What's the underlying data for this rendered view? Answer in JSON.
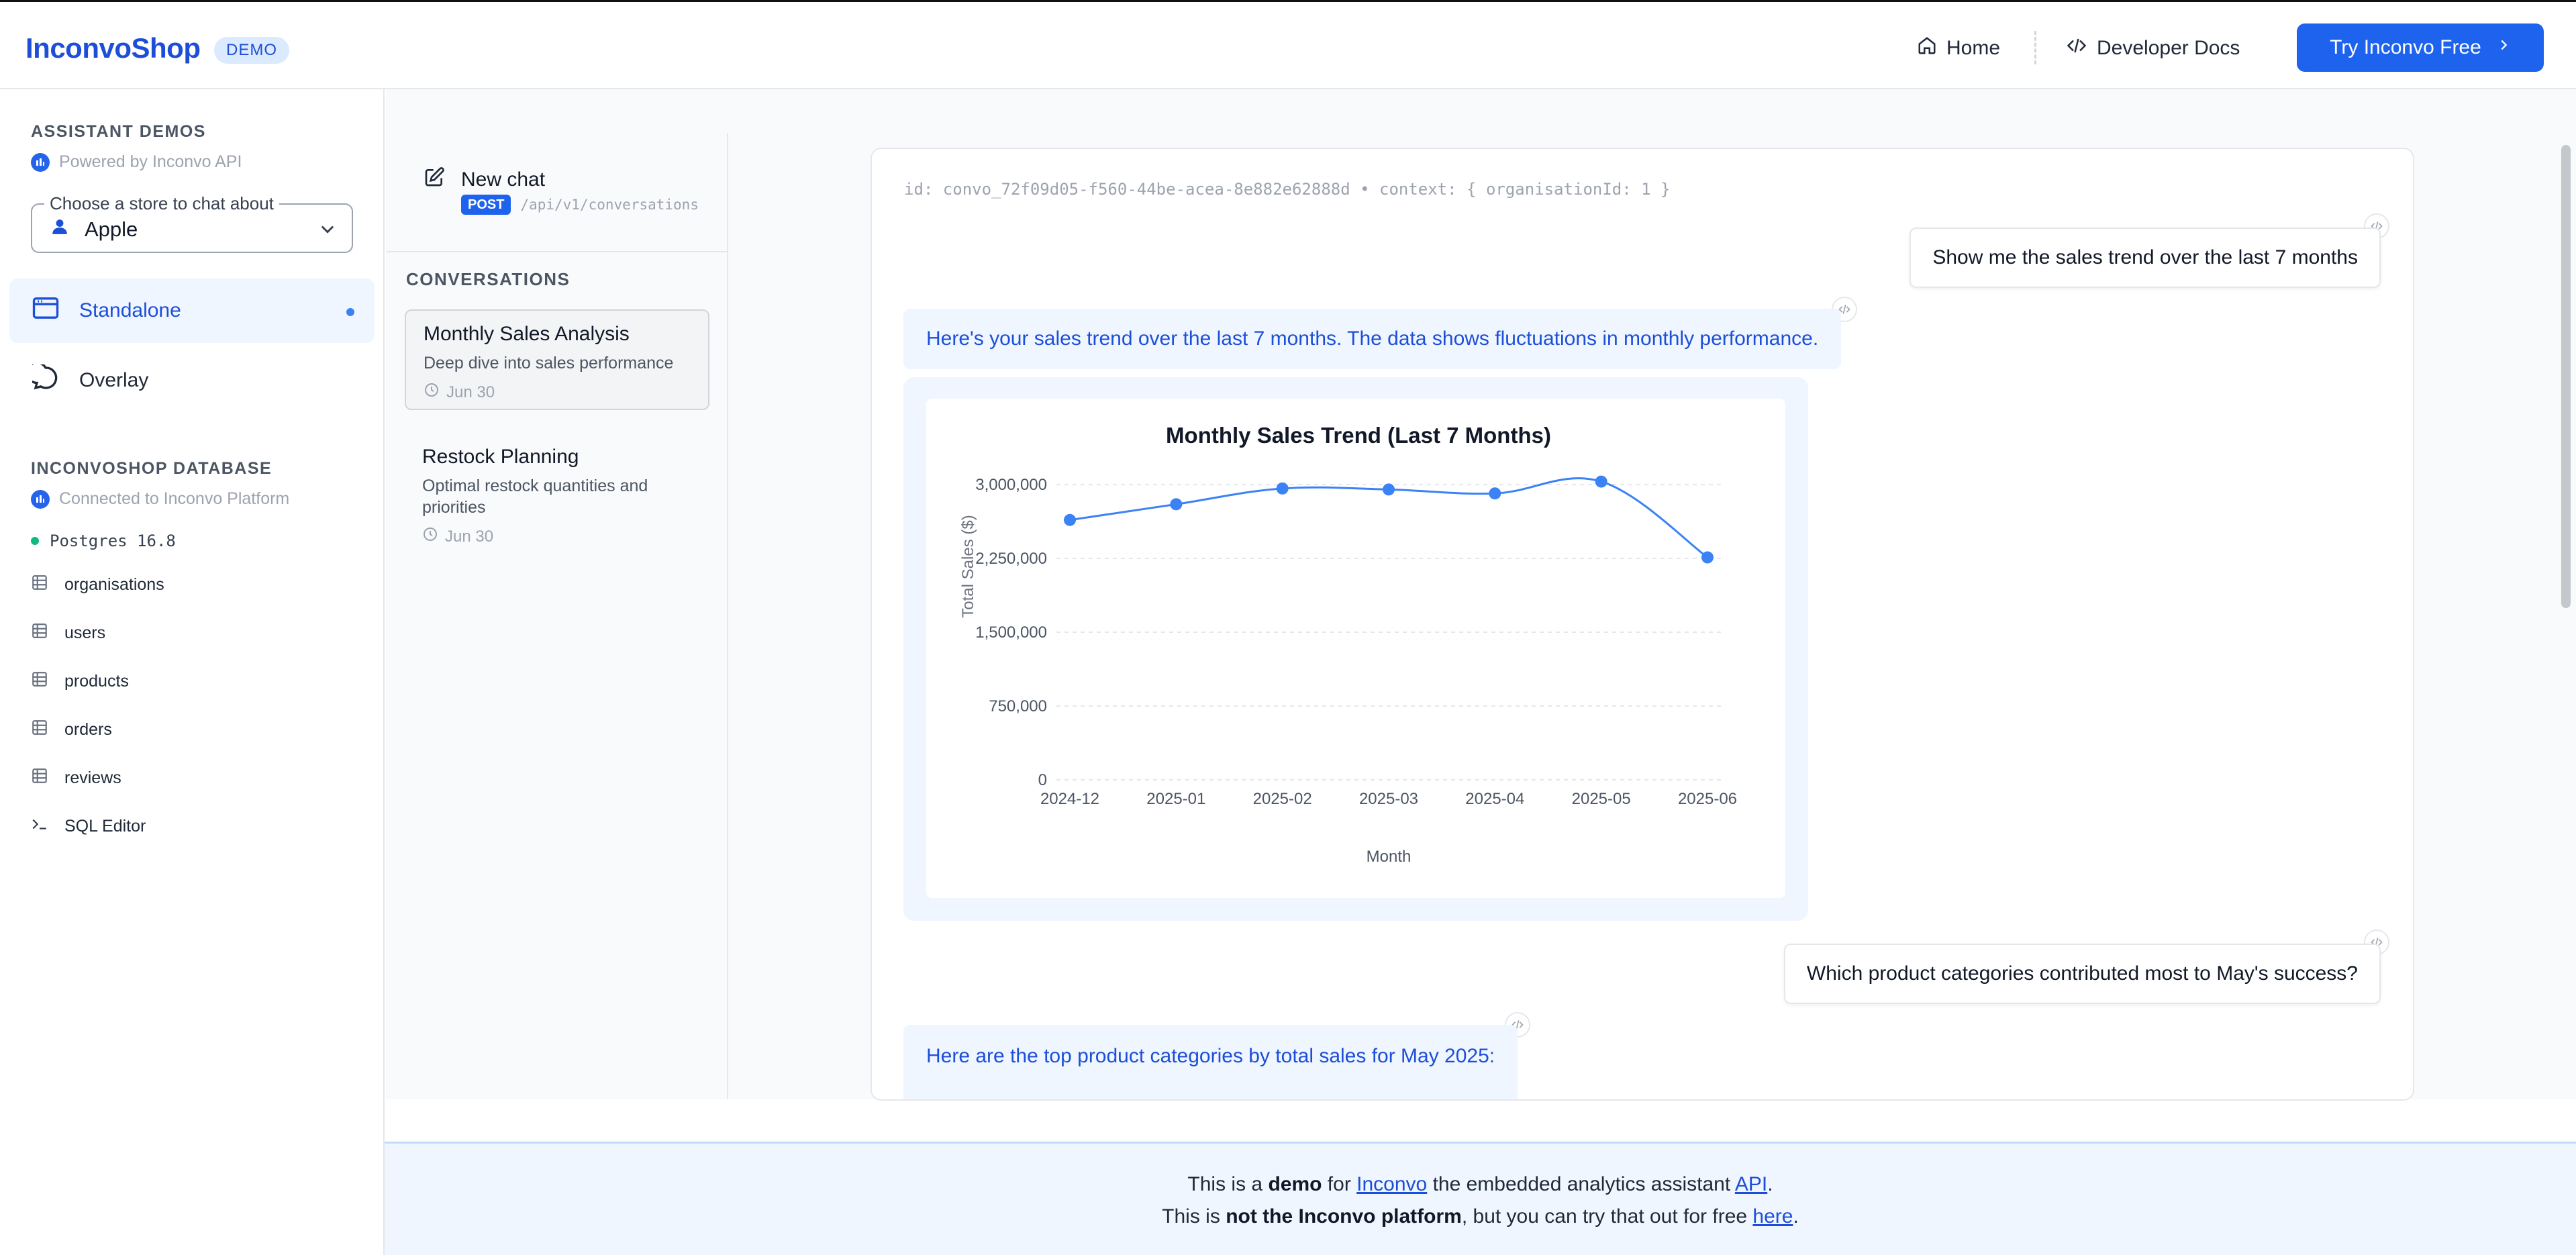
{
  "header": {
    "brand": "InconvoShop",
    "badge": "DEMO",
    "nav_home": "Home",
    "nav_docs": "Developer Docs",
    "cta": "Try Inconvo Free"
  },
  "sidebar": {
    "assistant_title": "ASSISTANT DEMOS",
    "assistant_sub": "Powered by Inconvo API",
    "store_legend": "Choose a store to chat about",
    "store_value": "Apple",
    "items": [
      {
        "label": "Standalone",
        "icon": "window-icon",
        "active": true
      },
      {
        "label": "Overlay",
        "icon": "chat-bubble-icon",
        "active": false
      }
    ],
    "db_title": "INCONVOSHOP DATABASE",
    "db_sub": "Connected to Inconvo Platform",
    "db_engine": "Postgres 16.8",
    "tables": [
      "organisations",
      "users",
      "products",
      "orders",
      "reviews"
    ],
    "sql_editor": "SQL Editor"
  },
  "conversations": {
    "new_chat": "New chat",
    "post_badge": "POST",
    "post_path": "/api/v1/conversations",
    "title": "CONVERSATIONS",
    "items": [
      {
        "title": "Monthly Sales Analysis",
        "subtitle": "Deep dive into sales performance",
        "date": "Jun 30",
        "selected": true
      },
      {
        "title": "Restock Planning",
        "subtitle": "Optimal restock quantities and priorities",
        "date": "Jun 30",
        "selected": false
      }
    ]
  },
  "chat": {
    "id_line": "id: convo_72f09d05-f560-44be-acea-8e882e62888d • context: { organisationId: 1 }",
    "messages": [
      {
        "role": "user",
        "text": "Show me the sales trend over the last 7 months"
      },
      {
        "role": "assistant",
        "text": "Here's your sales trend over the last 7 months. The data shows fluctuations in monthly performance."
      },
      {
        "role": "user",
        "text": "Which product categories contributed most to May's success?"
      },
      {
        "role": "assistant",
        "text": "Here are the top product categories by total sales for May 2025:"
      }
    ]
  },
  "chart_data": {
    "type": "line",
    "title": "Monthly Sales Trend (Last 7 Months)",
    "xlabel": "Month",
    "ylabel": "Total Sales ($)",
    "categories": [
      "2024-12",
      "2025-01",
      "2025-02",
      "2025-03",
      "2025-04",
      "2025-05",
      "2025-06"
    ],
    "values": [
      2640000,
      2800000,
      2960000,
      2950000,
      2910000,
      3030000,
      2260000
    ],
    "ylim": [
      0,
      3000000
    ],
    "yticks": [
      0,
      750000,
      1500000,
      2250000,
      3000000
    ],
    "ytick_labels": [
      "0",
      "750,000",
      "1,500,000",
      "2,250,000",
      "3,000,000"
    ],
    "grid": true,
    "color": "#3b82f6"
  },
  "footer": {
    "l1_pre": "This is a ",
    "l1_bold": "demo",
    "l1_mid": " for ",
    "l1_link1": "Inconvo",
    "l1_mid2": " the embedded analytics assistant ",
    "l1_link2": "API",
    "l1_end": ".",
    "l2_pre": "This is ",
    "l2_bold": "not the Inconvo platform",
    "l2_mid": ", but you can try that out for free ",
    "l2_link": "here",
    "l2_end": "."
  }
}
